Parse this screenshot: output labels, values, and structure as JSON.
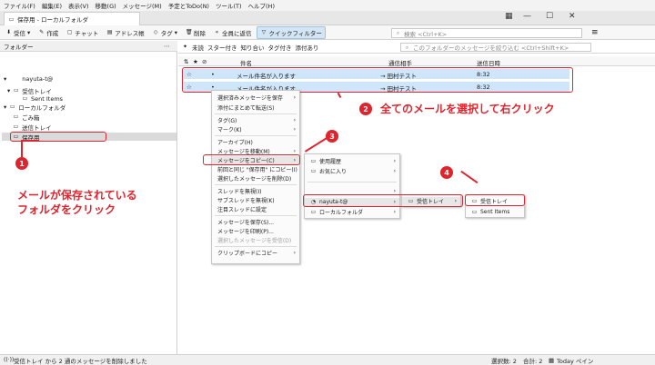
{
  "menubar": [
    "ファイル(F)",
    "編集(E)",
    "表示(V)",
    "移動(G)",
    "メッセージ(M)",
    "予定とToDo(N)",
    "ツール(T)",
    "ヘルプ(H)"
  ],
  "tab": {
    "title": "保存用 - ローカルフォルダ"
  },
  "toolbar": [
    {
      "label": "受信",
      "icon": "download-icon"
    },
    {
      "label": "作成",
      "icon": "pencil-icon"
    },
    {
      "label": "チャット",
      "icon": "chat-icon"
    },
    {
      "label": "アドレス帳",
      "icon": "address-book-icon"
    },
    {
      "label": "タグ",
      "icon": "tag-icon"
    },
    {
      "label": "削除",
      "icon": "trash-icon"
    },
    {
      "label": "全員に返信",
      "icon": "reply-all-icon"
    },
    {
      "label": "クイックフィルター",
      "icon": "filter-icon"
    }
  ],
  "search": {
    "placeholder": "検索 <Ctrl+K>"
  },
  "sidebar": {
    "header": "フォルダー",
    "account": "nayuta-t@",
    "inbox": "受信トレイ",
    "sent": "Sent Items",
    "local": "ローカルフォルダ",
    "trash": "ごみ箱",
    "outbox": "送信トレイ",
    "saved": "保存用"
  },
  "filterbar": {
    "items": [
      "未読",
      "スター付き",
      "知り合い",
      "タグ付き",
      "添付あり"
    ],
    "placeholder": "このフォルダーのメッセージを絞り込む <Ctrl+Shift+K>"
  },
  "columns": {
    "subject": "件名",
    "from": "通信相手",
    "date": "送信日時"
  },
  "messages": [
    {
      "subject": "メール件名が入ります",
      "from": "→ 田村テスト",
      "date": "8:32"
    },
    {
      "subject": "メール件名が入ります",
      "from": "→ 田村テスト",
      "date": "8:32"
    }
  ],
  "context_menu": {
    "items": [
      "選択済みメッセージを保存",
      "添付にまとめて転送(S)",
      "タグ(G)",
      "マーク(K)",
      "アーカイブ(H)",
      "メッセージを移動(M)",
      "メッセージをコピー(C)",
      "前回と同じ \"保存用\" にコピー(I)",
      "選択したメッセージを削除(D)",
      "スレッドを無視(I)",
      "サブスレッドを無視(K)",
      "注目スレッドに設定",
      "メッセージを保存(S)...",
      "メッセージを印刷(P)...",
      "選択したメッセージを受信(D)",
      "クリップボードにコピー"
    ]
  },
  "submenu1": {
    "items": [
      "使用履歴",
      "お気に入り",
      "nayuta-t@",
      "ローカルフォルダ"
    ]
  },
  "submenu2": {
    "items": [
      "受信トレイ"
    ]
  },
  "submenu3": {
    "items": [
      "受信トレイ",
      "Sent Items"
    ]
  },
  "annotations": {
    "b1": "1",
    "b2": "2",
    "b3": "3",
    "b4": "4",
    "note1_line1": "メールが保存されている",
    "note1_line2": "フォルダをクリック",
    "note2": "全てのメールを選択して右クリック"
  },
  "statusbar": {
    "text": "受信トレイ から 2 通のメッセージを削除しました",
    "selected": "選択数: 2",
    "total": "合計: 2",
    "today": "Today ペイン"
  }
}
